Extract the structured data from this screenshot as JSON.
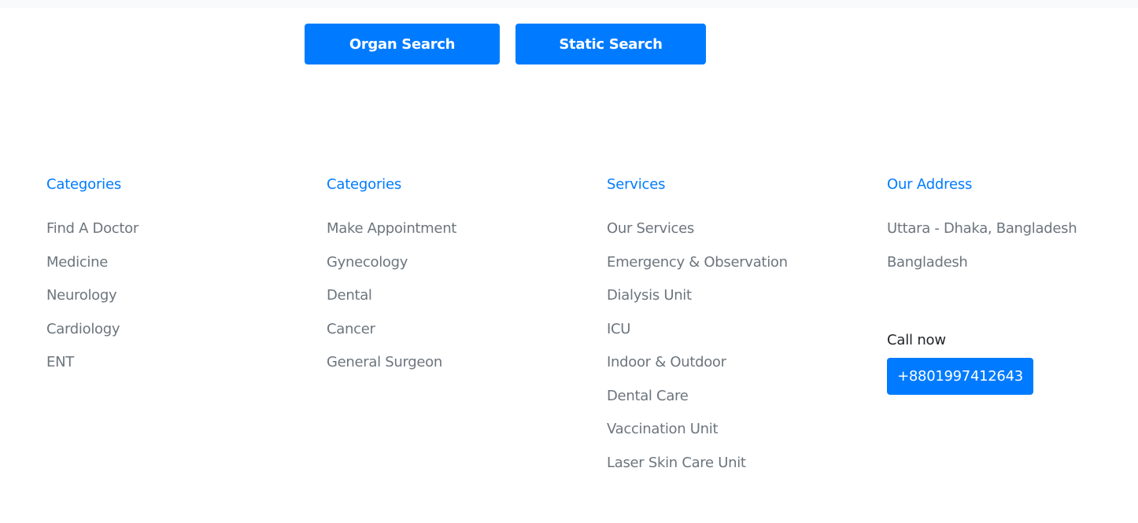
{
  "search_buttons": {
    "organ_label": "Organ Search",
    "static_label": "Static Search"
  },
  "footer": {
    "col1": {
      "heading": "Categories",
      "items": [
        "Find A Doctor",
        "Medicine",
        "Neurology",
        "Cardiology",
        "ENT"
      ]
    },
    "col2": {
      "heading": "Categories",
      "items": [
        "Make Appointment",
        "Gynecology",
        "Dental",
        "Cancer",
        "General Surgeon"
      ]
    },
    "col3": {
      "heading": "Services",
      "items": [
        "Our Services",
        "Emergency & Observation",
        "Dialysis Unit",
        "ICU",
        "Indoor & Outdoor",
        "Dental Care",
        "Vaccination Unit",
        "Laser Skin Care Unit"
      ]
    },
    "address": {
      "heading": "Our Address",
      "line1": "Uttara - Dhaka, Bangladesh",
      "line2": "Bangladesh",
      "call_label": "Call now",
      "phone": "+8801997412643"
    }
  },
  "colors": {
    "accent": "#007bff",
    "muted_text": "#6c757d",
    "dark_text": "#212529",
    "top_band": "#f8f9fa"
  }
}
